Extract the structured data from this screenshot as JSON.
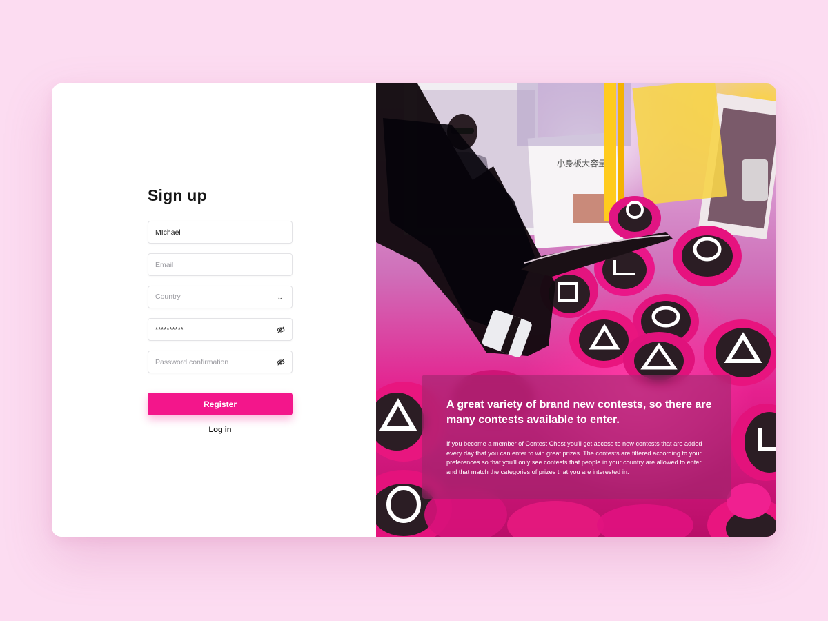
{
  "signup": {
    "title": "Sign up",
    "name_value": "MIchael",
    "email_placeholder": "Email",
    "country_placeholder": "Country",
    "password_value": "**********",
    "password_confirm_placeholder": "Password confirmation",
    "register_label": "Register",
    "login_label": "Log in"
  },
  "promo": {
    "headline": "A great variety of brand new contests, so there are many contests available to enter.",
    "body": "If you become a member of Contest Chest you'll get access to new contests that are added every day that you can enter to win great prizes. The contests are filtered according to your preferences so that you'll only see contests that people in your country are allowed to enter and that match the categories of prizes that you are interested in.",
    "photo_sign_text": "小身板大容量"
  },
  "colors": {
    "page_bg": "#fcdcf1",
    "accent": "#f3168b",
    "card_bg": "#ffffff"
  },
  "icons": {
    "password_toggle": "eye-slash-icon",
    "country_dropdown": "chevron-down-icon"
  }
}
